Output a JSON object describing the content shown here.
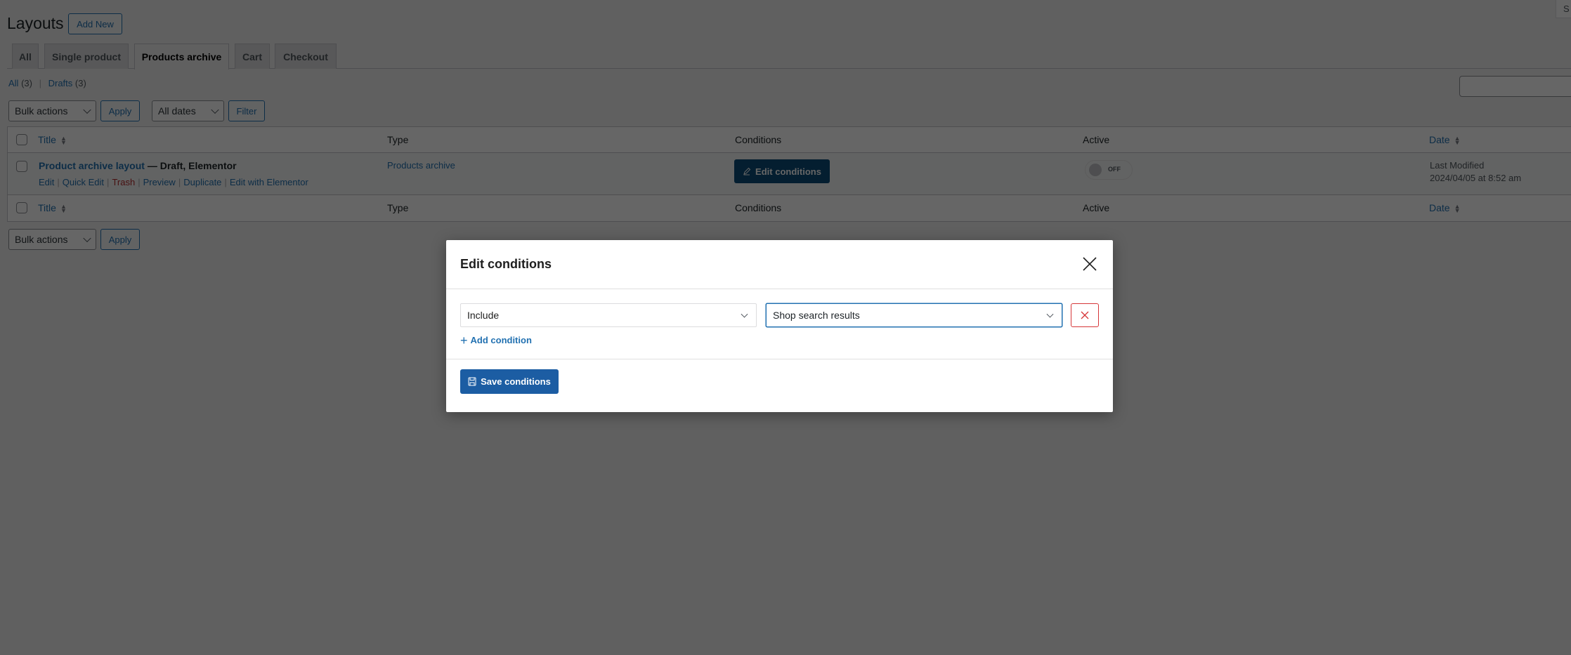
{
  "page": {
    "title": "Layouts",
    "add_new_label": "Add New",
    "screen_options_label": "S"
  },
  "tabs": [
    {
      "label": "All",
      "active": false
    },
    {
      "label": "Single product",
      "active": false
    },
    {
      "label": "Products archive",
      "active": true
    },
    {
      "label": "Cart",
      "active": false
    },
    {
      "label": "Checkout",
      "active": false
    }
  ],
  "filters": {
    "all_label": "All",
    "all_count": "(3)",
    "drafts_label": "Drafts",
    "drafts_count": "(3)",
    "separator": "|"
  },
  "toolbar": {
    "bulk_actions": "Bulk actions",
    "apply_label": "Apply",
    "dates": "All dates",
    "filter_label": "Filter",
    "search_value": ""
  },
  "table": {
    "columns": {
      "title": "Title",
      "type": "Type",
      "conditions": "Conditions",
      "active": "Active",
      "date": "Date"
    },
    "rows": [
      {
        "title": "Product archive layout",
        "state": "— Draft, Elementor",
        "actions": [
          "Edit",
          "Quick Edit",
          "Trash",
          "Preview",
          "Duplicate",
          "Edit with Elementor"
        ],
        "type": "Products archive",
        "conditions_button": "Edit conditions",
        "active_label": "OFF",
        "active": false,
        "date_label": "Last Modified",
        "date_value": "2024/04/05 at 8:52 am"
      }
    ]
  },
  "bottom_toolbar": {
    "bulk_actions": "Bulk actions",
    "apply_label": "Apply"
  },
  "modal": {
    "title": "Edit conditions",
    "condition": {
      "mode": "Include",
      "target": "Shop search results"
    },
    "add_condition_label": "Add condition",
    "save_label": "Save conditions"
  },
  "colors": {
    "primary": "#2271b1",
    "save_button": "#1c5da3",
    "edit_conditions_button": "#0a4b78",
    "danger": "#d63638"
  }
}
